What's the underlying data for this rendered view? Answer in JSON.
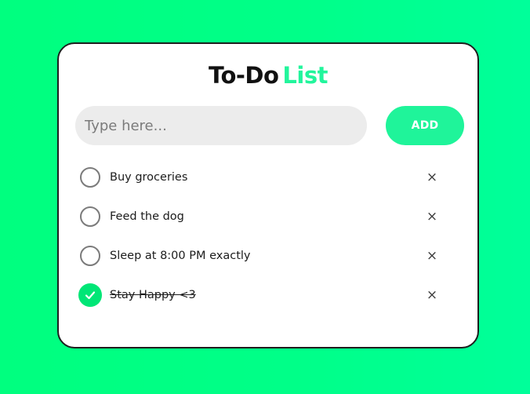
{
  "app": {
    "title_part1": "To-Do",
    "title_part2": "List"
  },
  "input": {
    "placeholder": "Type here...",
    "value": ""
  },
  "add_button": {
    "label": "ADD"
  },
  "tasks": [
    {
      "text": "Buy groceries",
      "completed": false
    },
    {
      "text": "Feed the dog",
      "completed": false
    },
    {
      "text": "Sleep at 8:00 PM exactly",
      "completed": false
    },
    {
      "text": "Stay Happy <3",
      "completed": true
    }
  ],
  "icons": {
    "checkbox_unchecked": "circle-outline-icon",
    "checkbox_checked": "check-circle-icon",
    "delete": "close-icon"
  },
  "delete_symbol": "×",
  "colors": {
    "background": "#00ff88",
    "accent": "#1ff49a",
    "check_fill": "#00e676",
    "card_border": "#1e1e1e"
  }
}
